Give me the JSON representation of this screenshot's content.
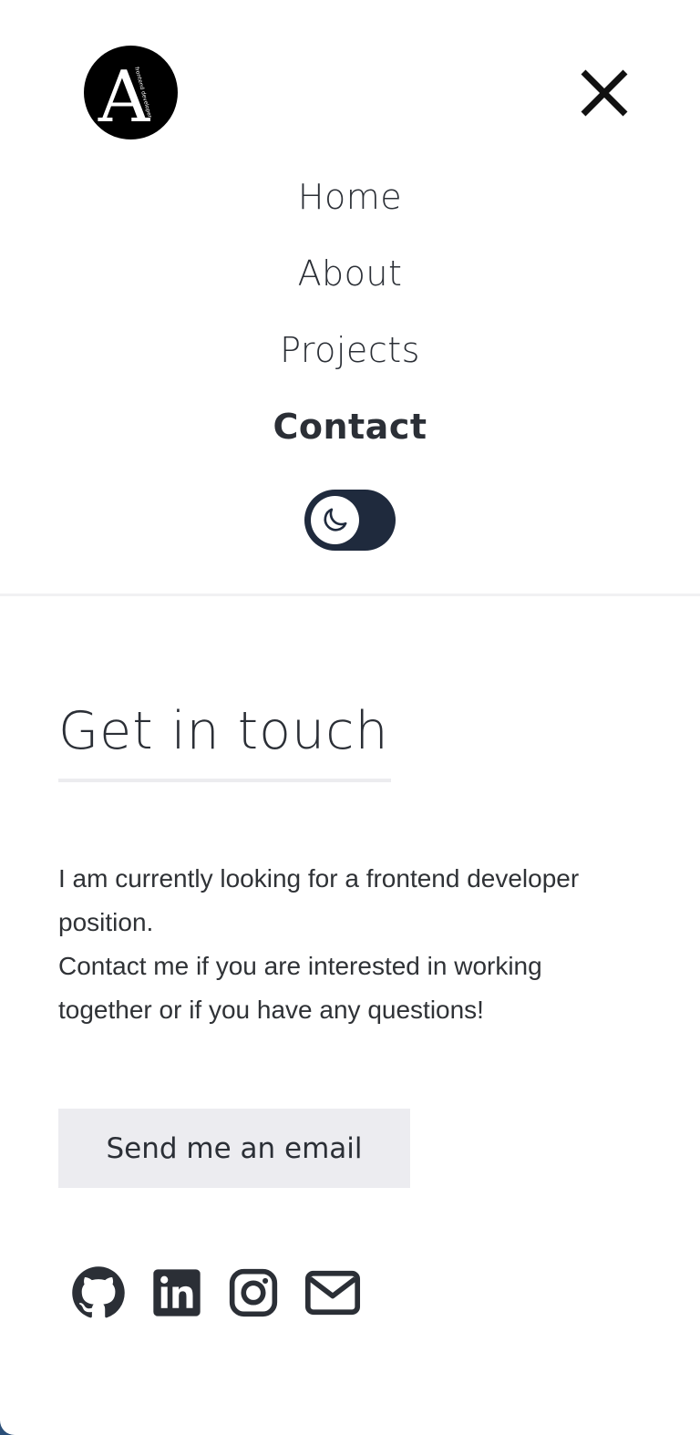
{
  "header": {
    "logo": {
      "letter": "A",
      "tagline": "frontend developer"
    },
    "close_icon": "close-icon",
    "nav": [
      {
        "label": "Home",
        "active": false
      },
      {
        "label": "About",
        "active": false
      },
      {
        "label": "Projects",
        "active": false
      },
      {
        "label": "Contact",
        "active": true
      }
    ],
    "theme_toggle": {
      "icon": "moon-icon",
      "state": "dark"
    }
  },
  "contact": {
    "title": "Get in touch",
    "paragraph_1": "I am currently looking for a frontend developer position.",
    "paragraph_2": "Contact me if you are interested in working together or if you have any questions!",
    "button_label": "Send me an email"
  },
  "socials": [
    {
      "name": "github",
      "icon": "github-icon"
    },
    {
      "name": "linkedin",
      "icon": "linkedin-icon"
    },
    {
      "name": "instagram",
      "icon": "instagram-icon"
    },
    {
      "name": "email",
      "icon": "envelope-icon"
    }
  ],
  "colors": {
    "text": "#2b2f36",
    "toggle_bg": "#1f2a3d",
    "button_bg": "#ececf0",
    "corner_accent": "#2b4f78"
  }
}
